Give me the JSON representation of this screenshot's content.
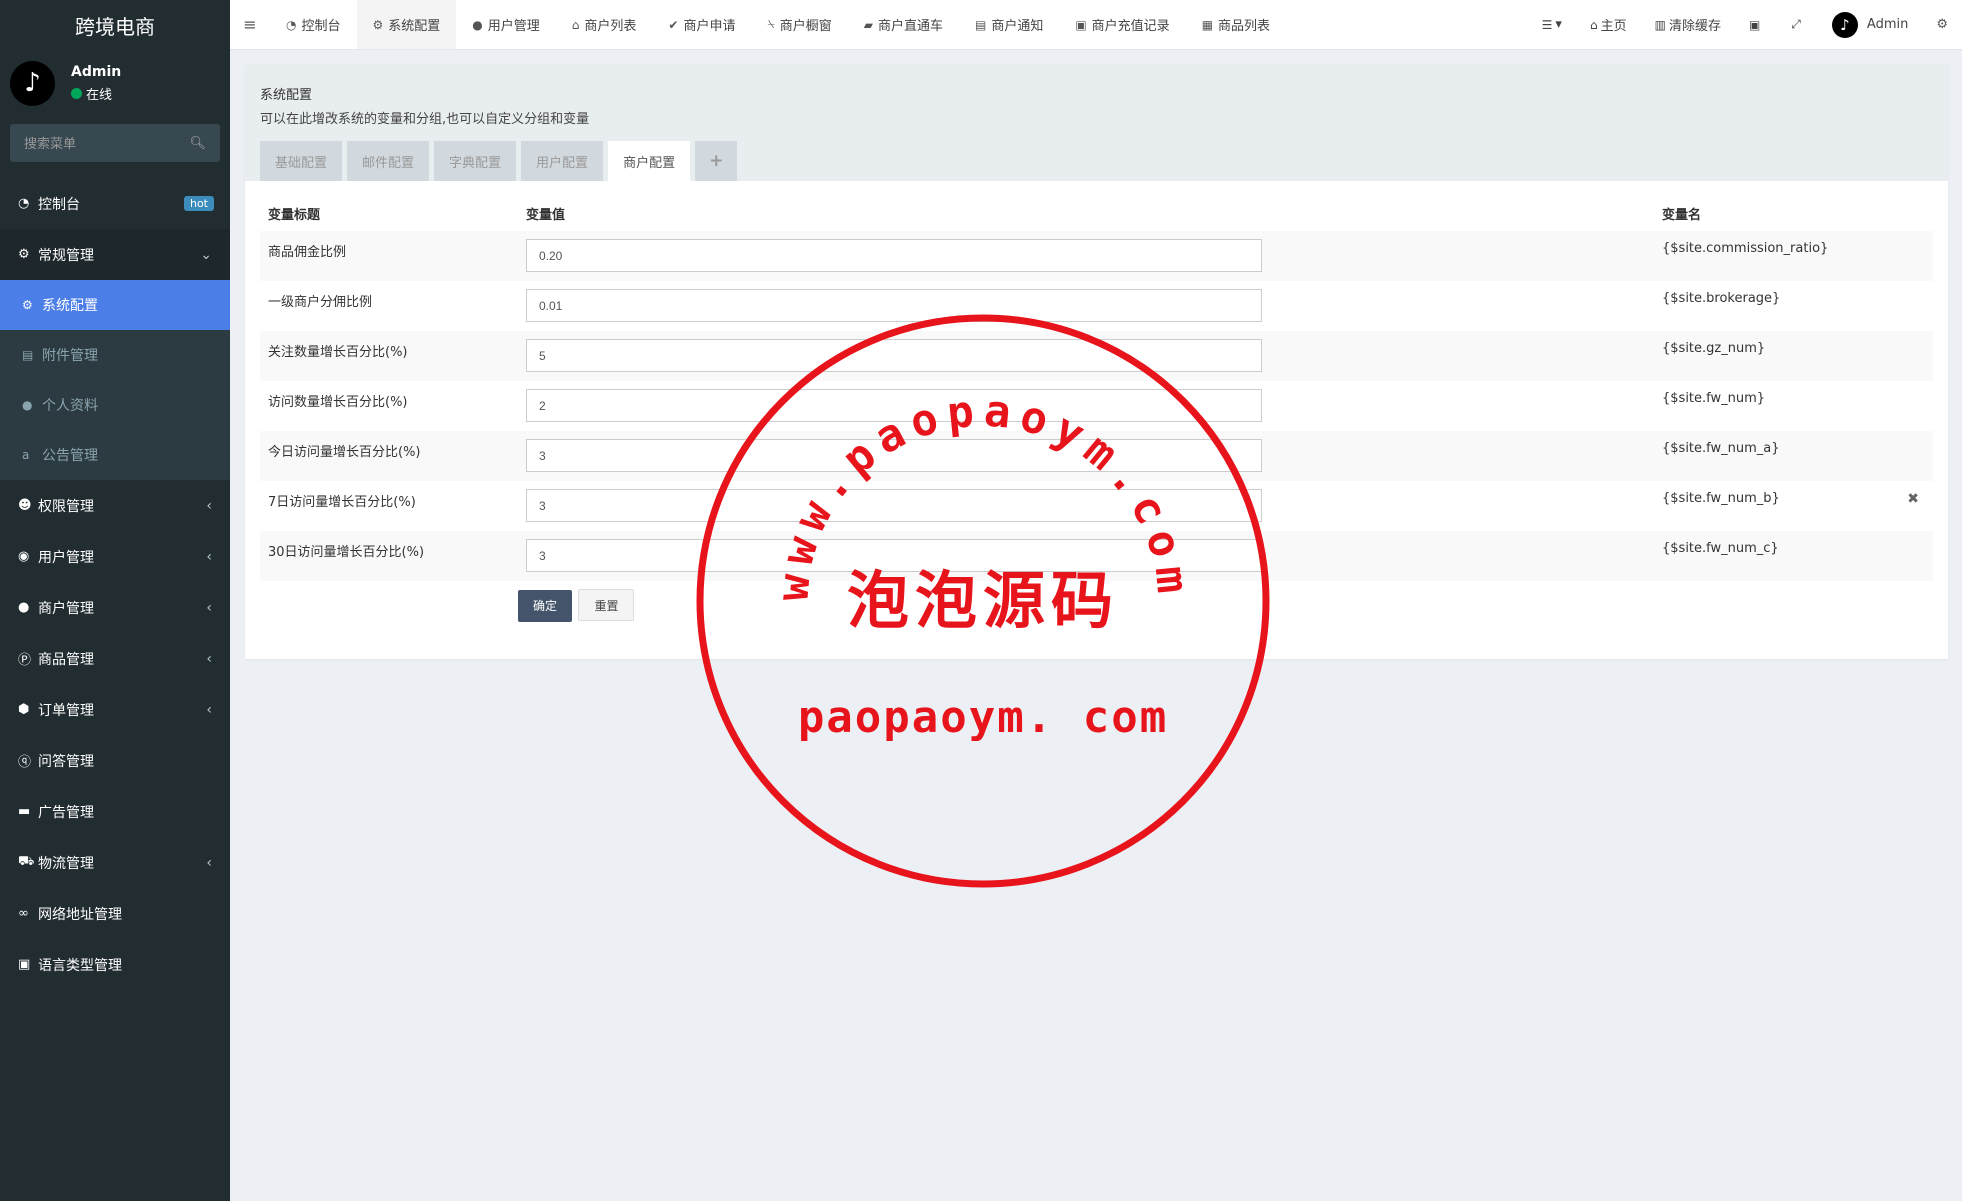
{
  "app": {
    "title": "跨境电商"
  },
  "user": {
    "name": "Admin",
    "status": "在线",
    "avatar_glyph": "♪"
  },
  "sidebar": {
    "search_placeholder": "搜索菜单",
    "items": [
      {
        "label": "控制台",
        "icon": "dashboard-icon",
        "badge": "hot"
      },
      {
        "label": "常规管理",
        "icon": "cogs-icon",
        "open": true,
        "children": [
          {
            "label": "系统配置",
            "icon": "gear-icon",
            "active": true
          },
          {
            "label": "附件管理",
            "icon": "file-image-icon"
          },
          {
            "label": "个人资料",
            "icon": "user-icon"
          },
          {
            "label": "公告管理",
            "icon": "amazon-icon"
          }
        ]
      },
      {
        "label": "权限管理",
        "icon": "group-icon"
      },
      {
        "label": "用户管理",
        "icon": "user-circle-icon"
      },
      {
        "label": "商户管理",
        "icon": "apple-icon"
      },
      {
        "label": "商品管理",
        "icon": "product-icon"
      },
      {
        "label": "订单管理",
        "icon": "cube-icon"
      },
      {
        "label": "问答管理",
        "icon": "question-icon"
      },
      {
        "label": "广告管理",
        "icon": "credit-card-icon"
      },
      {
        "label": "物流管理",
        "icon": "truck-icon"
      },
      {
        "label": "网络地址管理",
        "icon": "link-icon"
      },
      {
        "label": "语言类型管理",
        "icon": "language-icon"
      }
    ]
  },
  "header": {
    "tabs": [
      {
        "label": "控制台",
        "icon": "dashboard-icon"
      },
      {
        "label": "系统配置",
        "icon": "gear-icon",
        "active": true
      },
      {
        "label": "用户管理",
        "icon": "user-icon"
      },
      {
        "label": "商户列表",
        "icon": "home-icon"
      },
      {
        "label": "商户申请",
        "icon": "check-circle-icon"
      },
      {
        "label": "商户橱窗",
        "icon": "cart-icon"
      },
      {
        "label": "商户直通车",
        "icon": "car-icon"
      },
      {
        "label": "商户通知",
        "icon": "notice-icon"
      },
      {
        "label": "商户充值记录",
        "icon": "money-icon"
      },
      {
        "label": "商品列表",
        "icon": "shopping-bag-icon"
      }
    ],
    "right": {
      "home": "主页",
      "clear_cache": "清除缓存",
      "user": "Admin"
    }
  },
  "panel": {
    "title": "系统配置",
    "description": "可以在此增改系统的变量和分组,也可以自定义分组和变量",
    "tabs": [
      "基础配置",
      "邮件配置",
      "字典配置",
      "用户配置",
      "商户配置"
    ],
    "active_tab": "商户配置",
    "add_tab": "+"
  },
  "config_table": {
    "headers": {
      "title": "变量标题",
      "value": "变量值",
      "name": "变量名"
    },
    "rows": [
      {
        "title": "商品佣金比例",
        "value": "0.20",
        "name": "{$site.commission_ratio}"
      },
      {
        "title": "一级商户分佣比例",
        "value": "0.01",
        "name": "{$site.brokerage}"
      },
      {
        "title": "关注数量增长百分比(%)",
        "value": "5",
        "name": "{$site.gz_num}"
      },
      {
        "title": "访问数量增长百分比(%)",
        "value": "2",
        "name": "{$site.fw_num}"
      },
      {
        "title": "今日访问量增长百分比(%)",
        "value": "3",
        "name": "{$site.fw_num_a}"
      },
      {
        "title": "7日访问量增长百分比(%)",
        "value": "3",
        "name": "{$site.fw_num_b}",
        "deletable": true
      },
      {
        "title": "30日访问量增长百分比(%)",
        "value": "3",
        "name": "{$site.fw_num_c}"
      }
    ],
    "buttons": {
      "submit": "确定",
      "reset": "重置"
    }
  },
  "watermark": {
    "arc_text": "www.paopaoym.com",
    "center_text": "泡泡源码",
    "bottom_text": "paopaoym. com",
    "color": "#e8141b"
  },
  "colors": {
    "sidebar_bg": "#222d32",
    "active_blue": "#4c7ee8",
    "status_green": "#00a65a",
    "hot_badge": "#3c8dbc"
  }
}
